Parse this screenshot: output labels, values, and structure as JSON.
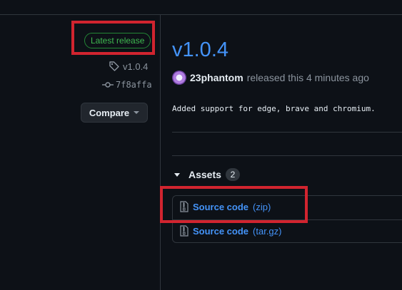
{
  "sidebar": {
    "latest_badge": "Latest release",
    "tag": "v1.0.4",
    "commit": "7f8affa",
    "compare_label": "Compare"
  },
  "release": {
    "title": "v1.0.4",
    "author": "23phantom",
    "released_text": "released this 4 minutes ago",
    "notes": "Added support for edge, brave and chromium."
  },
  "assets": {
    "heading": "Assets",
    "count": "2",
    "items": [
      {
        "name": "Source code",
        "ext": "(zip)",
        "icon": "zip-file-icon"
      },
      {
        "name": "Source code",
        "ext": "(tar.gz)",
        "icon": "zip-file-icon"
      }
    ]
  },
  "colors": {
    "background": "#0d1117",
    "link": "#4493f8",
    "latest_badge": "#3fb950",
    "highlight": "#d1242f"
  }
}
